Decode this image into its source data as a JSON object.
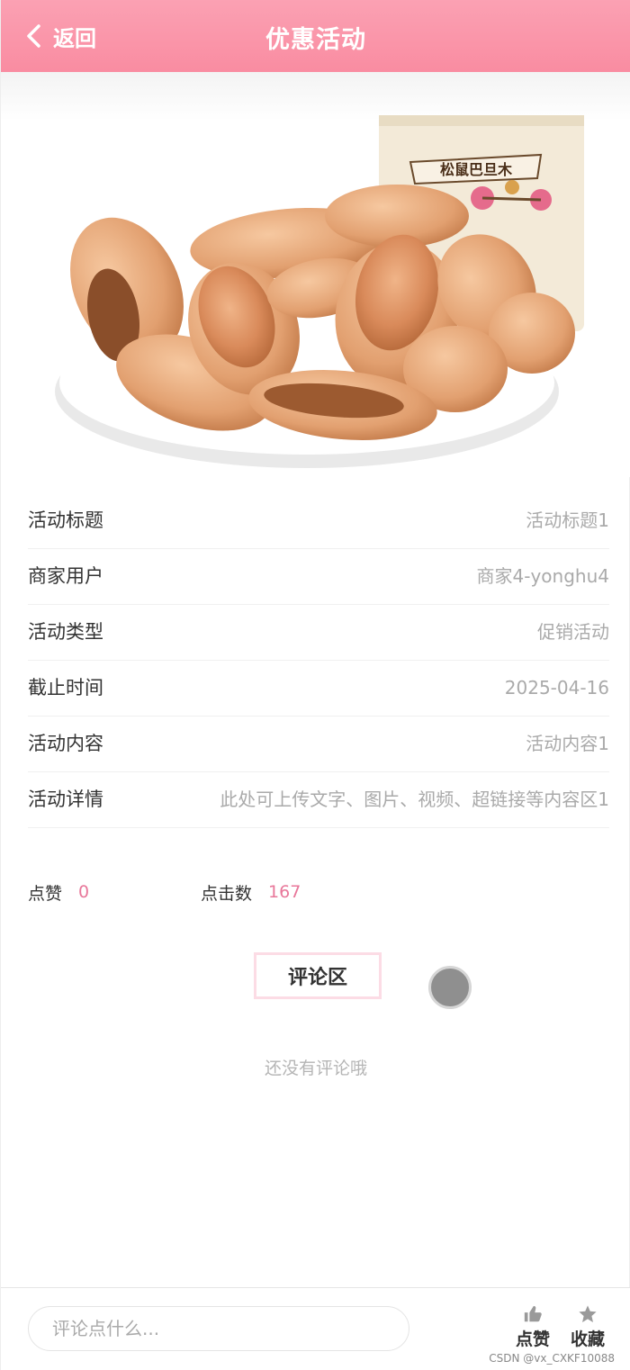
{
  "header": {
    "back_label": "返回",
    "title": "优惠活动",
    "bg_color": "#f98ca1"
  },
  "hero": {
    "package_brand": "松鼠巴旦木"
  },
  "info": {
    "rows": [
      {
        "label": "活动标题",
        "value": "活动标题1"
      },
      {
        "label": "商家用户",
        "value": "商家4-yonghu4"
      },
      {
        "label": "活动类型",
        "value": "促销活动"
      },
      {
        "label": "截止时间",
        "value": "2025-04-16"
      },
      {
        "label": "活动内容",
        "value": "活动内容1"
      },
      {
        "label": "活动详情",
        "value": "此处可上传文字、图片、视频、超链接等内容区1"
      }
    ]
  },
  "stats": {
    "like_label": "点赞",
    "like_count": "0",
    "click_label": "点击数",
    "click_count": "167",
    "accent_color": "#e8779a"
  },
  "comments": {
    "title": "评论区",
    "empty_text": "还没有评论哦"
  },
  "bottom_bar": {
    "input_placeholder": "评论点什么...",
    "like_label": "点赞",
    "favorite_label": "收藏"
  },
  "watermark": "CSDN @vx_CXKF10088"
}
